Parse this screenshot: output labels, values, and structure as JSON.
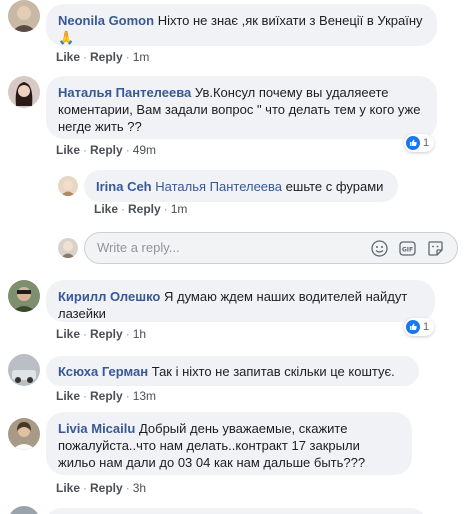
{
  "comments": [
    {
      "author": "Neonila Gomon",
      "text": "Ніхто не знає ,як виїхати з Венеції в Україну🙏",
      "like": "Like",
      "reply": "Reply",
      "time": "1m"
    },
    {
      "author": "Наталья Пантелеева",
      "text": "Ув.Консул почему вы удаляеете коментарии, Вам задали вопрос \" что делать тем у кого уже негде жить ??",
      "like": "Like",
      "reply": "Reply",
      "time": "49m",
      "reactions": "1"
    },
    {
      "author": "Irina Ceh",
      "mention": "Наталья Пантелеева",
      "text": "ешьте с фурами",
      "like": "Like",
      "reply": "Reply",
      "time": "1m"
    },
    {
      "author": "Кирилл Олешко",
      "text": "Я думаю ждем наших водителей найдут лазейки",
      "like": "Like",
      "reply": "Reply",
      "time": "1h",
      "reactions": "1"
    },
    {
      "author": "Ксюха Герман",
      "text": "Так і ніхто не запитав скільки це коштує.",
      "like": "Like",
      "reply": "Reply",
      "time": "13m"
    },
    {
      "author": "Livia Micailu",
      "text": "Добрый день уважаемые, скажите пожалуйста..что нам делать..контракт 17 закрыли жильо нам дали до 03 04 как нам дальше быть???",
      "like": "Like",
      "reply": "Reply",
      "time": "3h"
    }
  ],
  "reply_box": {
    "placeholder": "Write a reply..."
  },
  "icons": {
    "emoji": "smiley-icon",
    "gif": "gif-icon",
    "sticker": "sticker-icon"
  },
  "colors": {
    "author": "#385898",
    "bubble": "#f0f2f5",
    "like_blue": "#1877f2"
  }
}
